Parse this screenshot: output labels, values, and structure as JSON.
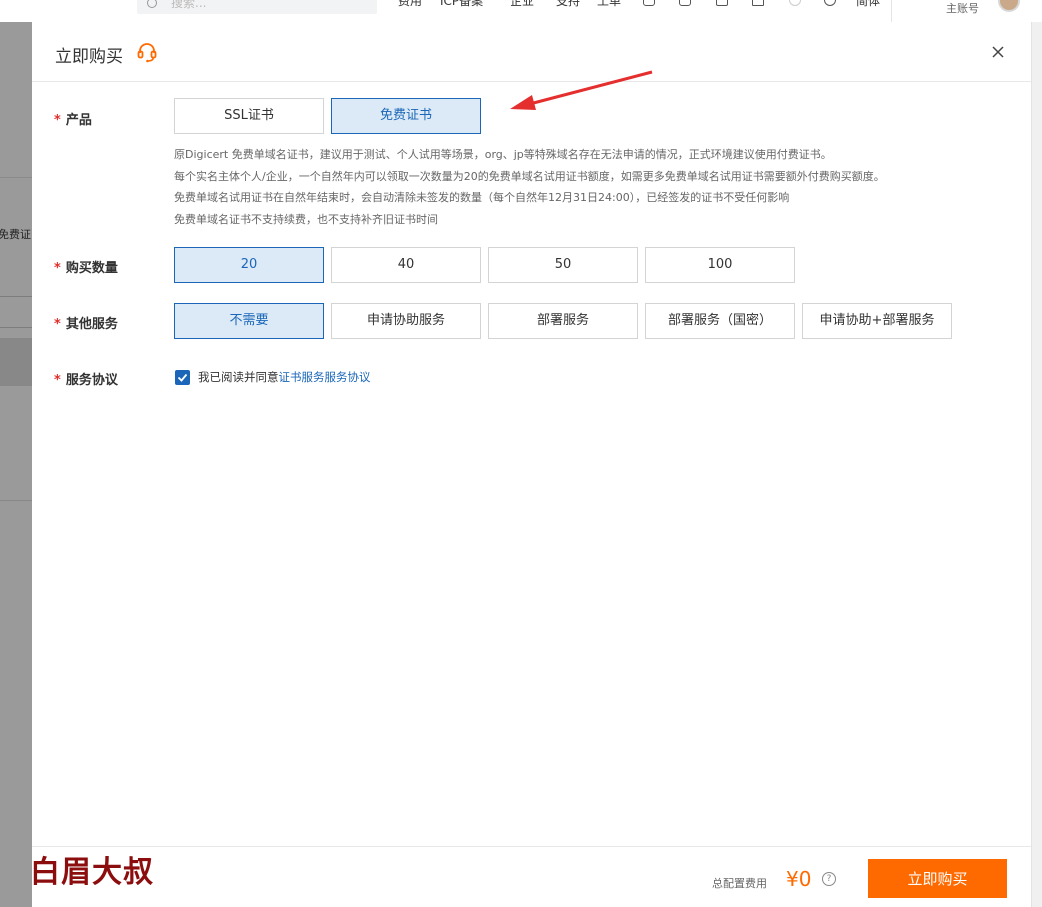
{
  "topbar": {
    "search_placeholder": "搜索...",
    "nav": [
      "费用",
      "ICP备案",
      "企业",
      "支持",
      "工单",
      "简体"
    ],
    "account_label": "主账号"
  },
  "background": {
    "cut_text": "免费证"
  },
  "drawer": {
    "title": "立即购买",
    "product": {
      "label": "产品",
      "options": [
        "SSL证书",
        "免费证书"
      ],
      "selected": "免费证书"
    },
    "description": [
      "原Digicert 免费单域名证书，建议用于测试、个人试用等场景，org、jp等特殊域名存在无法申请的情况，正式环境建议使用付费证书。",
      "每个实名主体个人/企业，一个自然年内可以领取一次数量为20的免费单域名试用证书额度，如需更多免费单域名试用证书需要额外付费购买额度。",
      "免费单域名试用证书在自然年结束时，会自动清除未签发的数量（每个自然年12月31日24:00），已经签发的证书不受任何影响",
      "免费单域名证书不支持续费，也不支持补齐旧证书时间"
    ],
    "quantity": {
      "label": "购买数量",
      "options": [
        "20",
        "40",
        "50",
        "100"
      ],
      "selected": "20"
    },
    "services": {
      "label": "其他服务",
      "options": [
        "不需要",
        "申请协助服务",
        "部署服务",
        "部署服务（国密）",
        "申请协助+部署服务"
      ],
      "selected": "不需要"
    },
    "agreement": {
      "label": "服务协议",
      "checked": true,
      "text": "我已阅读并同意",
      "link": "证书服务服务协议"
    },
    "required_mark": "*"
  },
  "footer": {
    "fee_label": "总配置费用",
    "fee_value": "¥0",
    "help": "?",
    "buy_label": "立即购买"
  },
  "watermark": "白眉大叔",
  "colors": {
    "accent": "#1b66b8",
    "selected_bg": "#dbeaf6",
    "orange": "#ff6a00",
    "required": "#e52e2e",
    "arrow": "#e52e2e"
  }
}
